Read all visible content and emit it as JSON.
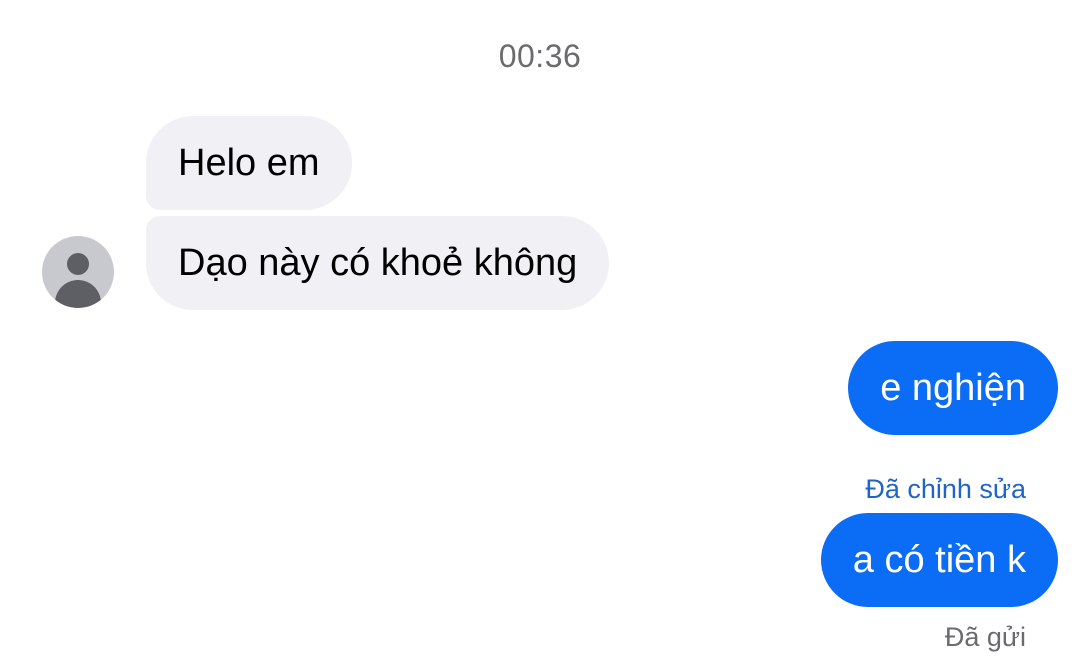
{
  "chat": {
    "timestamp": "00:36",
    "incoming": [
      {
        "text": "Helo em"
      },
      {
        "text": "Dạo này có khoẻ không"
      }
    ],
    "outgoing": [
      {
        "text": "e nghiện",
        "status": "Đã chỉnh sửa"
      },
      {
        "text": "a có tiền k",
        "status": "Đã gửi"
      }
    ]
  },
  "icons": {
    "avatar": "default-user-avatar-icon"
  },
  "colors": {
    "incoming_bubble": "#f0f0f5",
    "outgoing_bubble": "#0b6cf5",
    "edited_label": "#1f64c8",
    "muted_text": "#6b6b6f"
  }
}
